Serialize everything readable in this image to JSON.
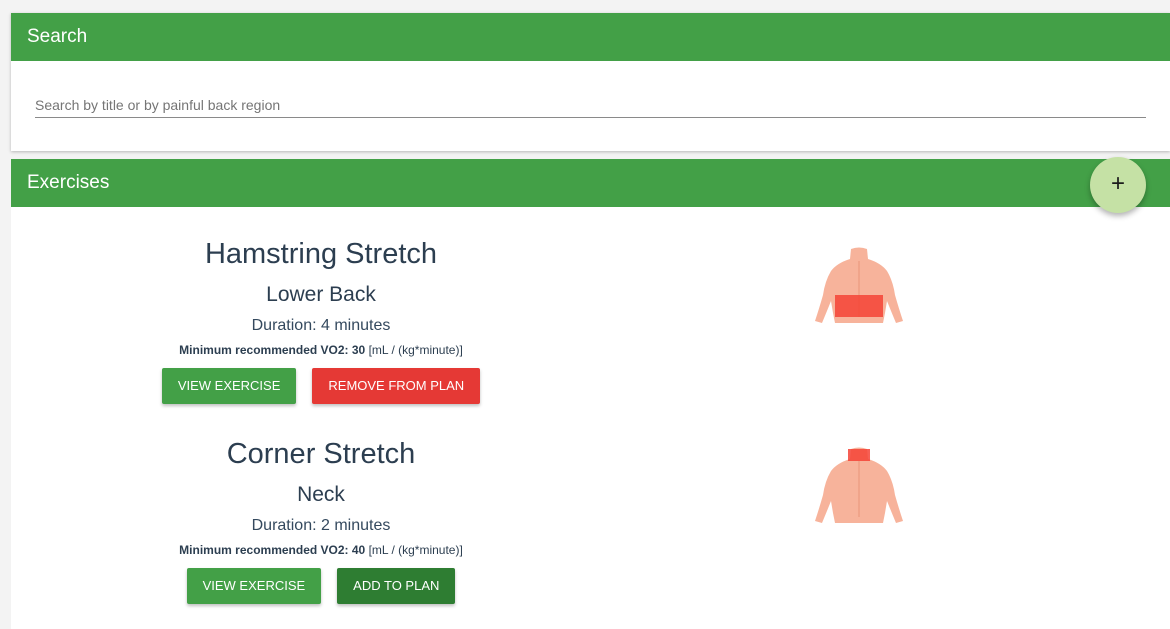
{
  "search": {
    "header": "Search",
    "placeholder": "Search by title or by painful back region"
  },
  "exercises": {
    "header": "Exercises",
    "fab_label": "+",
    "items": [
      {
        "title": "Hamstring Stretch",
        "region": "Lower Back",
        "duration": "Duration: 4 minutes",
        "vo2_label": "Minimum recommended VO2: 30",
        "vo2_unit": "[mL / (kg*minute)]",
        "view_label": "VIEW EXERCISE",
        "plan_label": "REMOVE FROM PLAN",
        "highlight_region": "lower-back"
      },
      {
        "title": "Corner Stretch",
        "region": "Neck",
        "duration": "Duration: 2 minutes",
        "vo2_label": "Minimum recommended VO2: 40",
        "vo2_unit": "[mL / (kg*minute)]",
        "view_label": "VIEW EXERCISE",
        "plan_label": "ADD TO PLAN",
        "highlight_region": "neck"
      }
    ]
  },
  "colors": {
    "header_green": "#43a047",
    "remove_red": "#e53935",
    "add_dark_green": "#2e7d32",
    "fab_light_green": "#c5e1a5",
    "highlight_red": "#f44336"
  }
}
